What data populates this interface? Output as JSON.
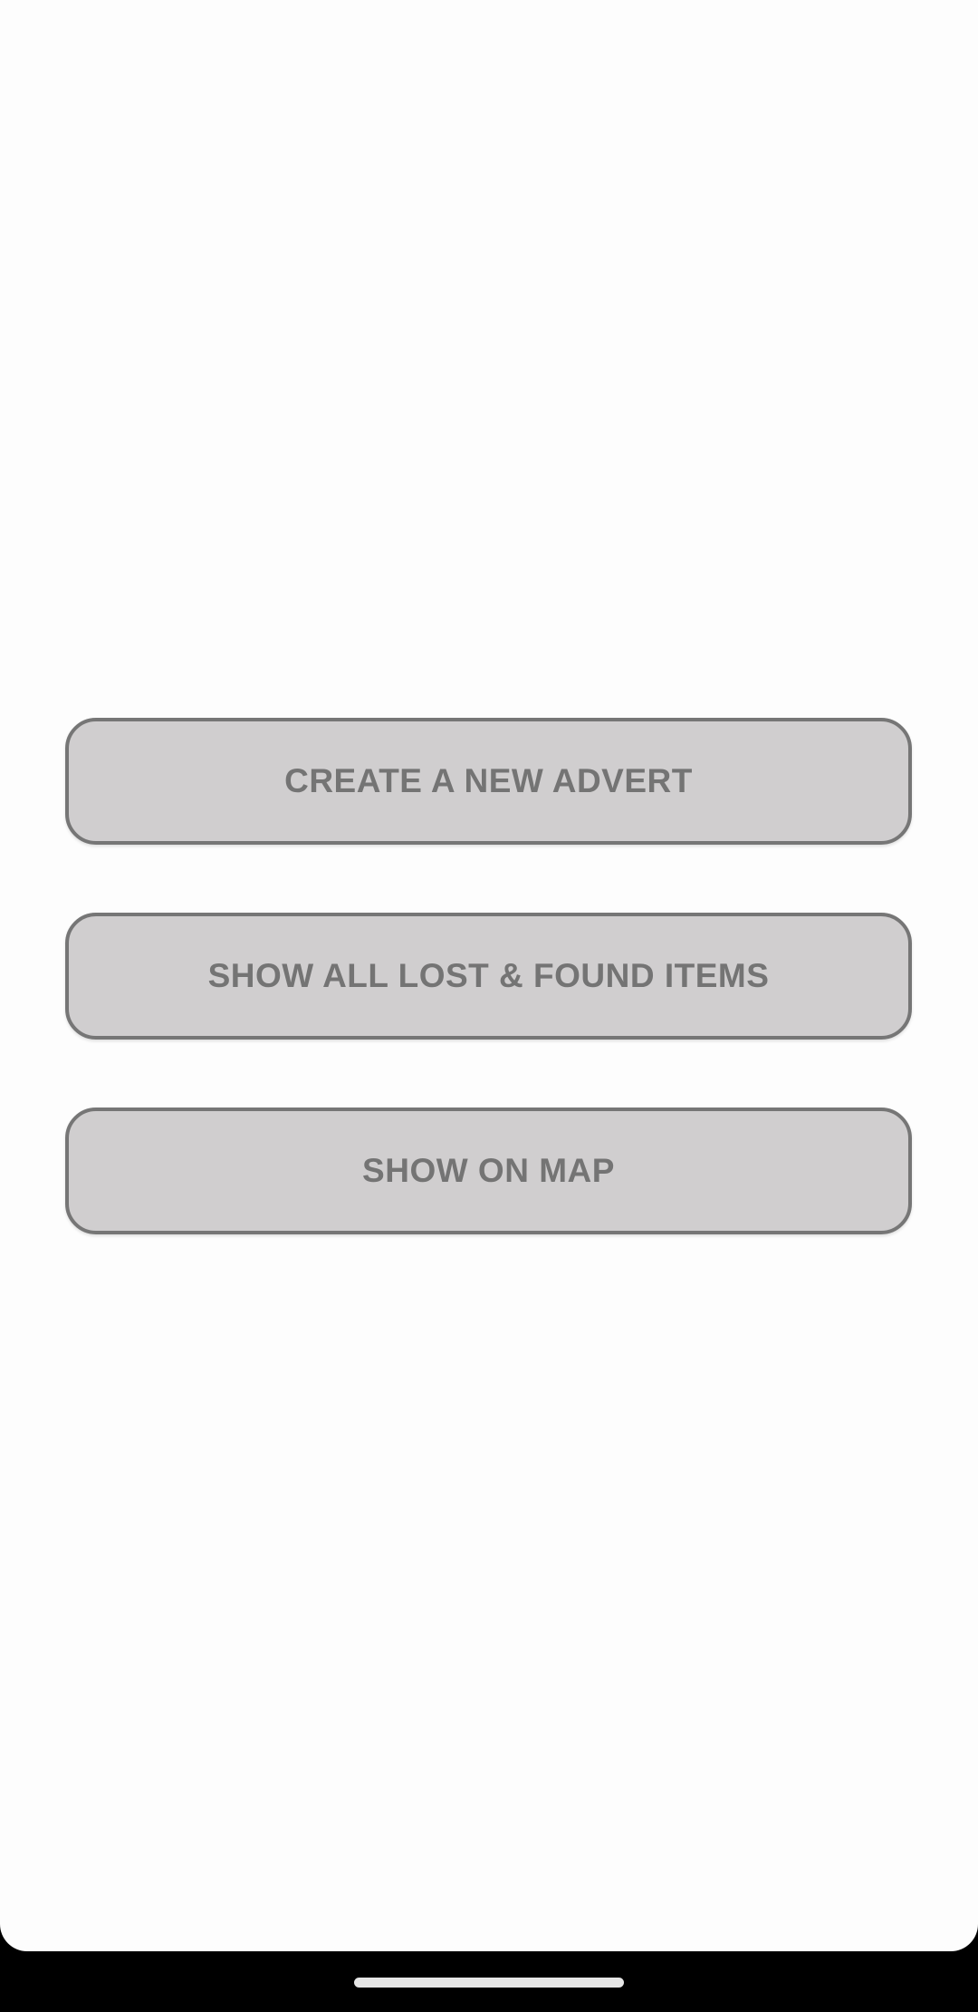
{
  "main": {
    "buttons": [
      {
        "label": "CREATE A NEW ADVERT"
      },
      {
        "label": "SHOW ALL LOST & FOUND ITEMS"
      },
      {
        "label": "SHOW ON MAP"
      }
    ]
  },
  "colors": {
    "background": "#fdfdfd",
    "button_fill": "#d0cecf",
    "button_border": "#767676",
    "button_text": "#747474",
    "nav_bar": "#000000",
    "home_handle": "#e6e6e6"
  }
}
